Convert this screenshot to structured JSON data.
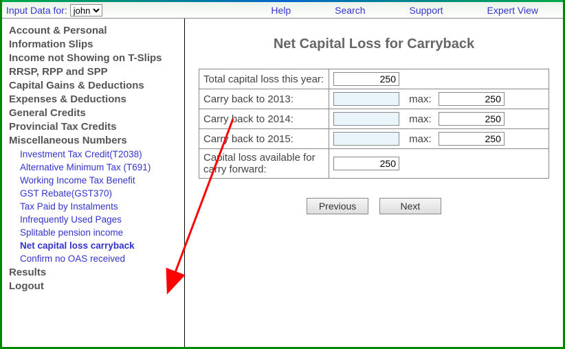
{
  "topbar": {
    "input_data_for": "Input Data for:",
    "user_options": [
      "john"
    ],
    "user_selected": "john",
    "help": "Help",
    "search": "Search",
    "support": "Support",
    "expert_view": "Expert View"
  },
  "sidebar": {
    "main": [
      "Account & Personal",
      "Information Slips",
      "Income not Showing on T-Slips",
      "RRSP, RPP and SPP",
      "Capital Gains & Deductions",
      "Expenses & Deductions",
      "General Credits",
      "Provincial Tax Credits",
      "Miscellaneous Numbers"
    ],
    "sub": [
      "Investment Tax Credit(T2038)",
      "Alternative Minimum Tax (T691)",
      "Working Income Tax Benefit",
      "GST Rebate(GST370)",
      "Tax Paid by Instalments",
      "Infrequently Used Pages",
      "Splitable pension income",
      "Net capital loss carryback",
      "Confirm no OAS received"
    ],
    "sub_active_index": 7,
    "results": "Results",
    "logout": "Logout"
  },
  "page": {
    "title": "Net Capital Loss for Carryback",
    "total_label": "Total capital loss this year:",
    "total_value": "250",
    "rows": [
      {
        "label": "Carry back to 2013:",
        "value": "",
        "max_label": "max:",
        "max_value": "250"
      },
      {
        "label": "Carry back to 2014:",
        "value": "",
        "max_label": "max:",
        "max_value": "250"
      },
      {
        "label": "Carry back to 2015:",
        "value": "",
        "max_label": "max:",
        "max_value": "250"
      }
    ],
    "available_label": "Capital loss available for carry forward:",
    "available_value": "250",
    "previous": "Previous",
    "next": "Next"
  },
  "colors": {
    "frame": "#008800",
    "link": "#3333cc",
    "text_muted": "#666666",
    "arrow": "#ff0000"
  }
}
